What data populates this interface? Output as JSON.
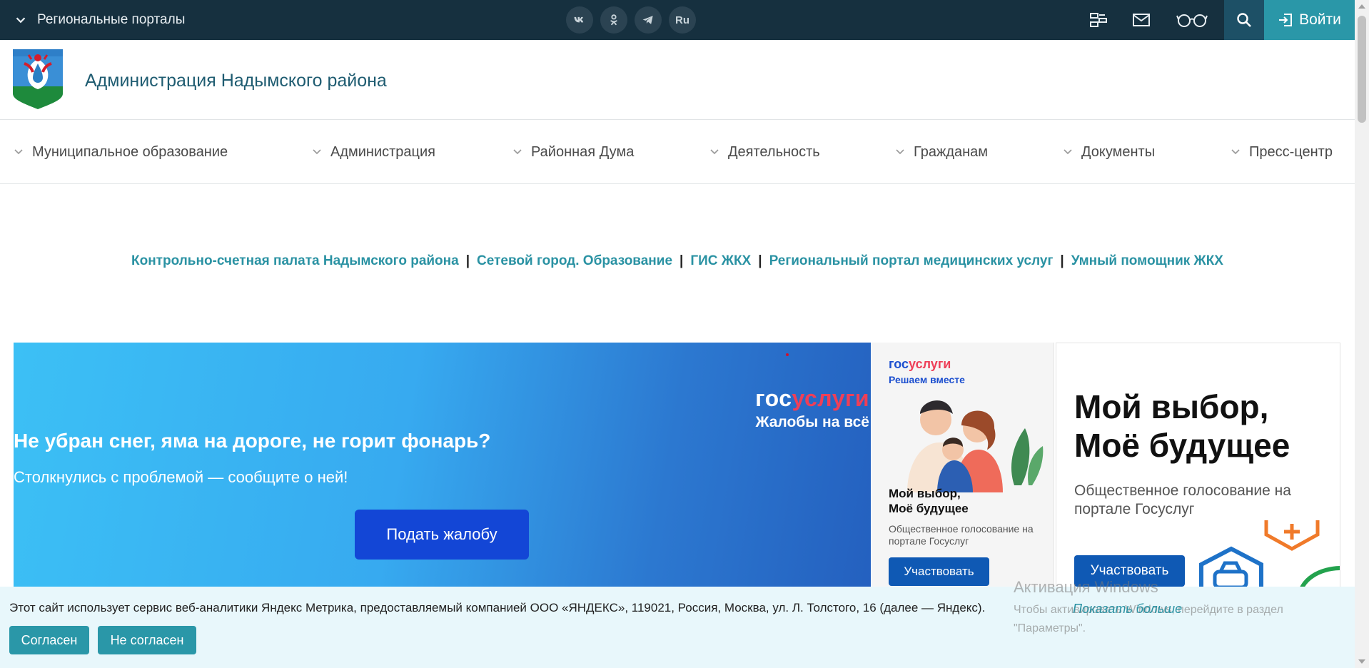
{
  "topbar": {
    "region_label": "Региональные порталы",
    "socials": [
      {
        "icon": "vk-icon",
        "label": ""
      },
      {
        "icon": "odnoklassniki-icon",
        "label": ""
      },
      {
        "icon": "telegram-icon",
        "label": ""
      },
      {
        "icon": "language-icon",
        "label": "Ru"
      }
    ],
    "icons": [
      "sitemap-icon",
      "mail-icon",
      "accessibility-glasses-icon",
      "search-icon"
    ],
    "login_label": "Войти",
    "colors": {
      "bar": "#16303f",
      "accent": "#2a97a8"
    }
  },
  "header": {
    "title": "Администрация Надымского района"
  },
  "nav": {
    "items": [
      {
        "label": "Муниципальное образование"
      },
      {
        "label": "Администрация"
      },
      {
        "label": "Районная Дума"
      },
      {
        "label": "Деятельность"
      },
      {
        "label": "Гражданам"
      },
      {
        "label": "Документы"
      },
      {
        "label": "Пресс-центр"
      }
    ]
  },
  "quick_links": {
    "items": [
      "Контрольно-счетная палата Надымского района",
      "Сетевой город. Образование",
      "ГИС ЖКХ",
      "Региональный портал медицинских услуг",
      "Умный помощник ЖКХ"
    ],
    "separator": "|"
  },
  "banner_main": {
    "brand_gos": "гос",
    "brand_uslugi": "услуги",
    "brand_sub": "Жалобы на всё",
    "title": "Не убран снег, яма на дороге, не горит фонарь?",
    "text": "Столкнулись с проблемой — сообщите о ней!",
    "button": "Подать жалобу"
  },
  "banner_card": {
    "brand_gos": "гос",
    "brand_uslugi": "услуги",
    "tag": "Решаем вместе",
    "title_line1": "Мой выбор,",
    "title_line2": "Моё будущее",
    "desc": "Общественное голосование на портале Госуслуг",
    "button": "Участвовать"
  },
  "banner_vote": {
    "title_line1": "Мой выбор,",
    "title_line2": "Моё будущее",
    "desc": "Общественное голосование на портале Госуслуг",
    "button": "Участвовать"
  },
  "cookie": {
    "text": "Этот сайт использует сервис веб-аналитики Яндекс Метрика, предоставляемый компанией ООО «ЯНДЕКС», 119021, Россия, Москва, ул. Л. Толстого, 16 (далее — Яндекс).",
    "agree": "Согласен",
    "disagree": "Не согласен",
    "show_more": "Показать больше"
  },
  "watermark": {
    "title": "Активация Windows",
    "text": "Чтобы активировать Windows, перейдите в раздел \"Параметры\"."
  }
}
